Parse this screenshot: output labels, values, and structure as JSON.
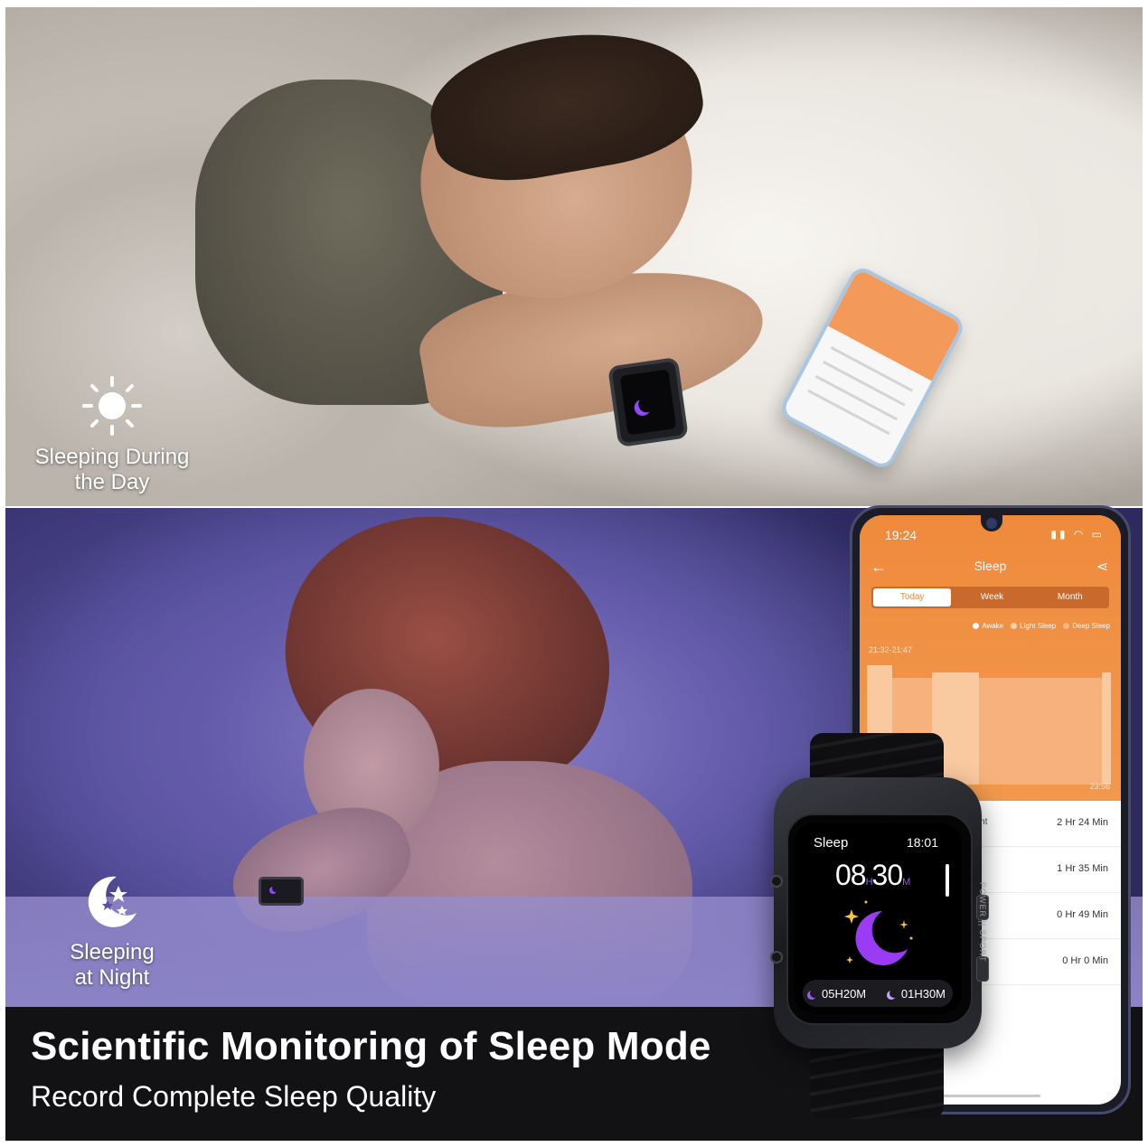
{
  "day_scene": {
    "caption_line1": "Sleeping During",
    "caption_line2": "the Day",
    "icon": "sun-icon"
  },
  "night_scene": {
    "caption_line1": "Sleeping",
    "caption_line2": "at Night",
    "icon": "moon-stars-icon"
  },
  "banner": {
    "headline": "Scientific Monitoring of Sleep Mode",
    "subline": "Record Complete Sleep Quality"
  },
  "phone": {
    "status_time": "19:24",
    "title": "Sleep",
    "tabs": [
      "Today",
      "Week",
      "Month"
    ],
    "active_tab": "Today",
    "legend": [
      {
        "label": "Awake",
        "color": "#ffffff"
      },
      {
        "label": "Light Sleep",
        "color": "#f9d3b0"
      },
      {
        "label": "Deep Sleep",
        "color": "#f6b784"
      }
    ],
    "range_start": "21:32-21:47",
    "range_end": "23:56",
    "rows": [
      {
        "label": "Night",
        "value": "2 Hr 24 Min"
      },
      {
        "label": "p",
        "value": "1 Hr 35 Min"
      },
      {
        "label": "p",
        "value": "0 Hr 49 Min"
      },
      {
        "label": "",
        "value": "0 Hr 0 Min"
      }
    ]
  },
  "watch": {
    "screen_title": "Sleep",
    "clock": "18:01",
    "duration_hours": "08",
    "duration_h_unit": "H",
    "duration_minutes": "30",
    "duration_m_unit": "M",
    "deep_sleep": "05H20M",
    "light_sleep": "01H30M",
    "side_label": "POWER  ||  SPORT"
  },
  "colors": {
    "accent_orange": "#ef8a3c",
    "accent_purple": "#9a5cf5",
    "banner_bg": "#121215"
  }
}
